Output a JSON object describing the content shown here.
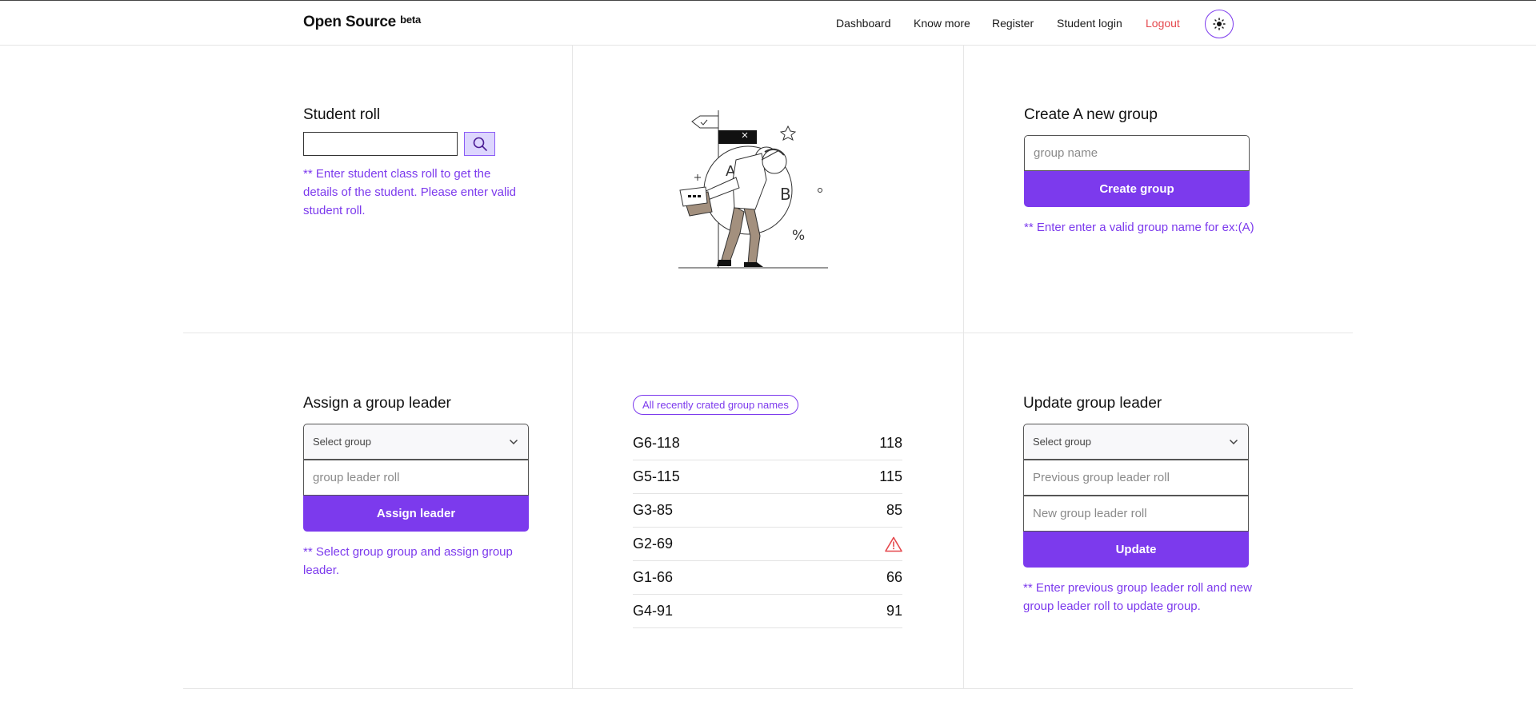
{
  "header": {
    "brand": "Open Source",
    "brand_badge": "beta",
    "nav": [
      {
        "label": "Dashboard"
      },
      {
        "label": "Know more"
      },
      {
        "label": "Register"
      },
      {
        "label": "Student login"
      },
      {
        "label": "Logout"
      }
    ],
    "theme_icon": "sun-icon"
  },
  "student_roll": {
    "title": "Student roll",
    "input_value": "",
    "search_icon": "search-icon",
    "hint": "** Enter student class roll to get the details of the student. Please enter valid student roll."
  },
  "illustration": {
    "letters": [
      "A",
      "B"
    ],
    "percent": "%"
  },
  "create_group": {
    "title": "Create A new group",
    "placeholder": "group name",
    "button": "Create group",
    "hint": "** Enter enter a valid group name for ex:(A)"
  },
  "assign_leader": {
    "title": "Assign a group leader",
    "select_value": "Select group",
    "placeholder": "group leader roll",
    "button": "Assign leader",
    "hint": "** Select group group and assign group leader."
  },
  "recent_groups": {
    "badge": "All recently crated group names",
    "items": [
      {
        "name": "G6-118",
        "value": "118"
      },
      {
        "name": "G5-115",
        "value": "115"
      },
      {
        "name": "G3-85",
        "value": "85"
      },
      {
        "name": "G2-69",
        "value": "",
        "icon": "warning-icon",
        "icon_color": "#e5484d"
      },
      {
        "name": "G1-66",
        "value": "66"
      },
      {
        "name": "G4-91",
        "value": "91"
      }
    ]
  },
  "update_leader": {
    "title": "Update group leader",
    "select_value": "Select group",
    "previous_placeholder": "Previous group leader roll",
    "new_placeholder": "New group leader roll",
    "button": "Update",
    "hint": "** Enter previous group leader roll and new group leader roll to update group."
  },
  "colors": {
    "accent": "#7c3aed",
    "accent_light": "#ddd6fe",
    "danger": "#e5484d"
  }
}
